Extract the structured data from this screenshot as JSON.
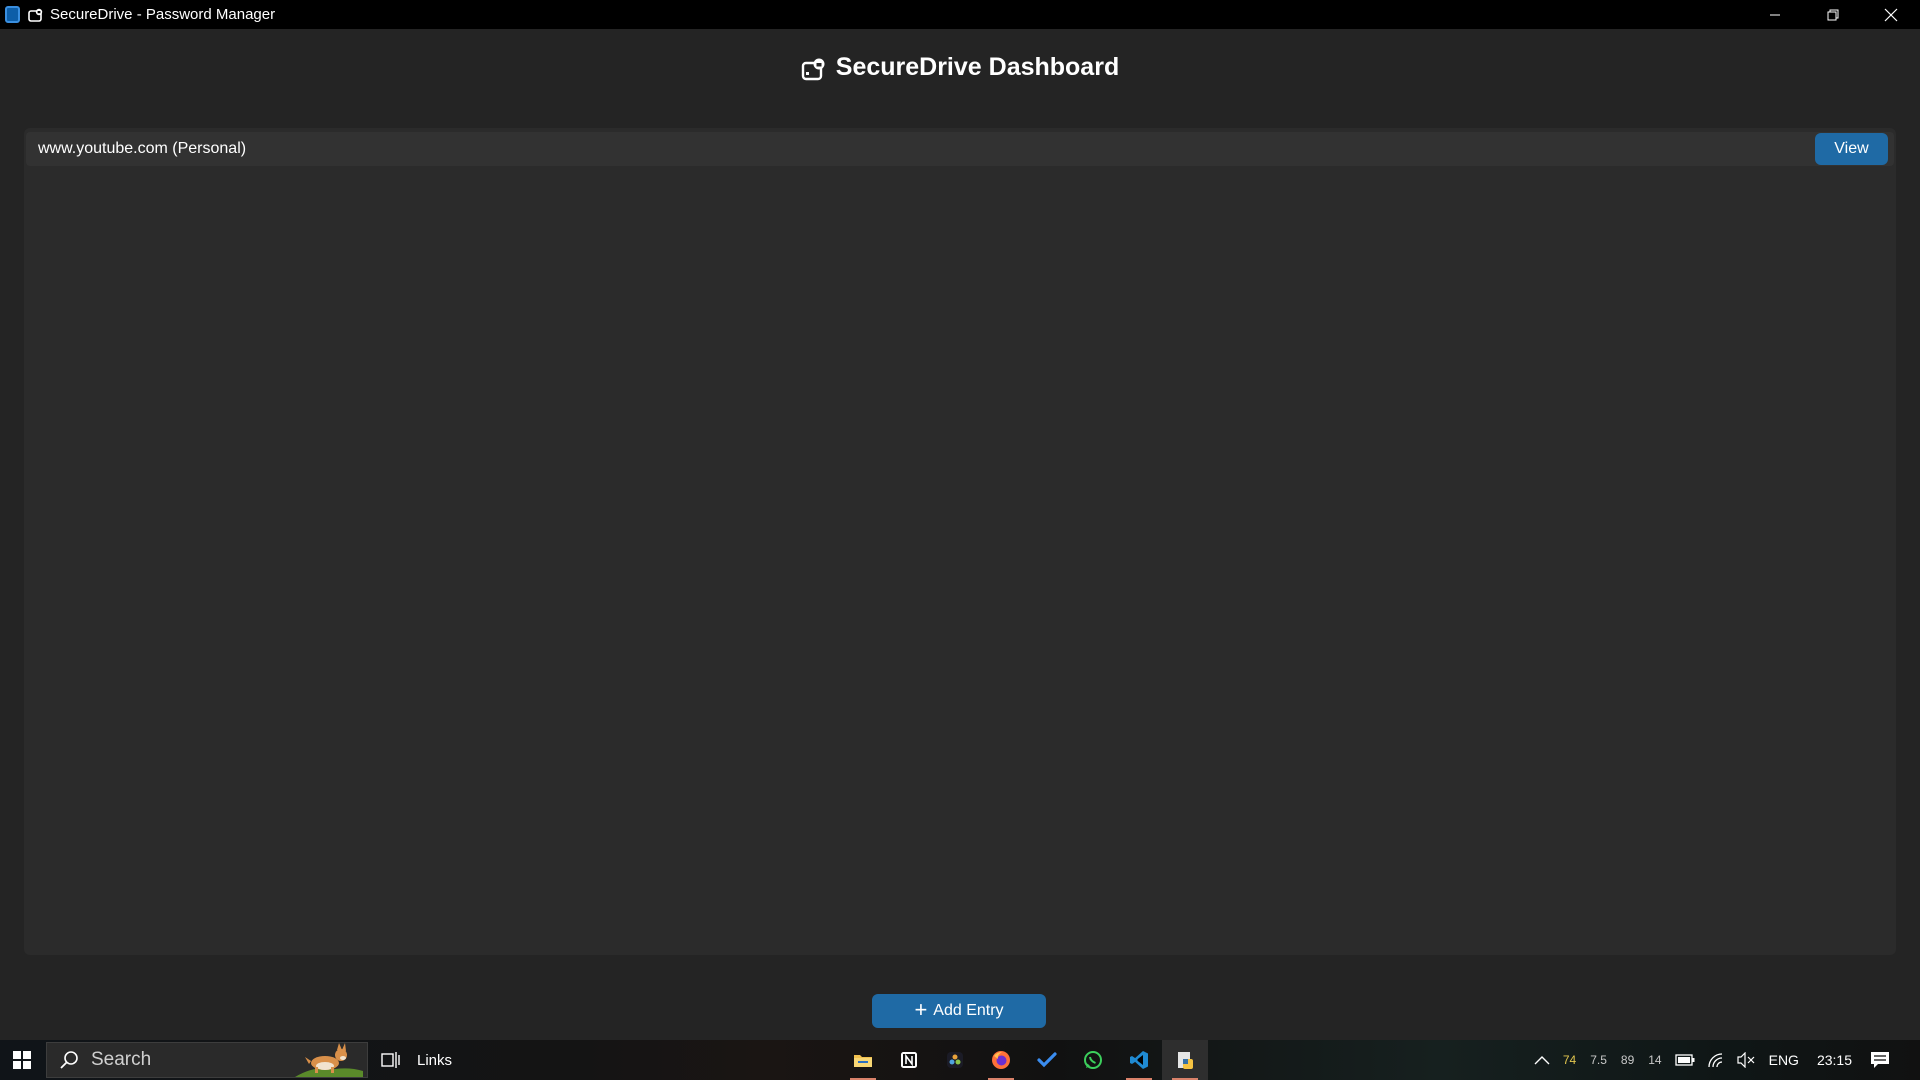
{
  "window": {
    "title": "SecureDrive - Password Manager"
  },
  "header": {
    "title": "SecureDrive Dashboard"
  },
  "entries": [
    {
      "label": "www.youtube.com (Personal)",
      "action_label": "View"
    }
  ],
  "footer": {
    "add_label": "Add Entry"
  },
  "taskbar": {
    "search_placeholder": "Search",
    "links_label": "Links",
    "pinned_apps": [
      "file-explorer",
      "notion",
      "davinci-resolve",
      "firefox",
      "todo",
      "whatsapp",
      "vscode",
      "securedrive"
    ],
    "tray": {
      "stat_1": "74",
      "stat_2": "7.5",
      "stat_3": "89",
      "stat_4": "14",
      "language": "ENG",
      "time": "23:15"
    }
  },
  "colors": {
    "background": "#242424",
    "panel": "#2b2b2b",
    "accent": "#1f6aa5",
    "titlebar": "#000000"
  }
}
